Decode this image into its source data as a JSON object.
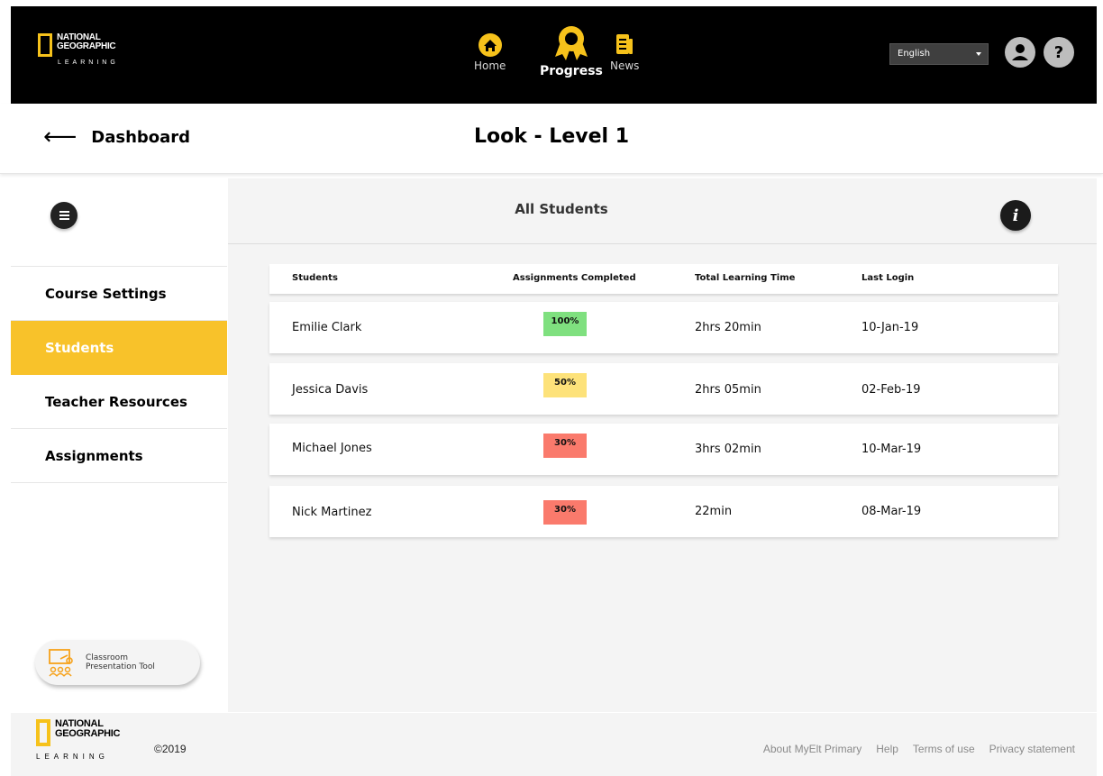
{
  "brand": {
    "logo_line1": "NATIONAL",
    "logo_line2": "GEOGRAPHIC",
    "logo_sub": "LEARNING"
  },
  "nav": {
    "home": "Home",
    "progress": "Progress",
    "news": "News",
    "active": "progress"
  },
  "language": {
    "selected": "English"
  },
  "header": {
    "back_label": "Dashboard",
    "title": "Look - Level 1"
  },
  "sidebar": {
    "items": [
      {
        "label": "Course Settings",
        "active": false
      },
      {
        "label": "Students",
        "active": true
      },
      {
        "label": "Teacher Resources",
        "active": false
      },
      {
        "label": "Assignments",
        "active": false
      }
    ],
    "cpt_line1": "Classroom",
    "cpt_line2": "Presentation Tool"
  },
  "main": {
    "title": "All Students",
    "columns": [
      "Students",
      "Assignments Completed",
      "Total Learning Time",
      "Last Login"
    ],
    "rows": [
      {
        "name": "Emilie Clark",
        "completed": "100%",
        "time": "2hrs  20min",
        "last_login": "10-Jan-19"
      },
      {
        "name": "Jessica Davis",
        "completed": "50%",
        "time": "2hrs  05min",
        "last_login": "02-Feb-19"
      },
      {
        "name": "Michael Jones",
        "completed": "30%",
        "time": "3hrs  02min",
        "last_login": "10-Mar-19"
      },
      {
        "name": "Nick Martinez",
        "completed": "30%",
        "time": "22min",
        "last_login": "08-Mar-19"
      }
    ]
  },
  "colors": {
    "accent": "#f8c22a",
    "badge_high": "#7fe07f",
    "badge_mid": "#fde27a",
    "badge_low": "#fa7a6c"
  },
  "footer": {
    "copyright": "©2019",
    "links": [
      "About MyElt Primary",
      "Help",
      "Terms of use",
      "Privacy statement"
    ]
  }
}
